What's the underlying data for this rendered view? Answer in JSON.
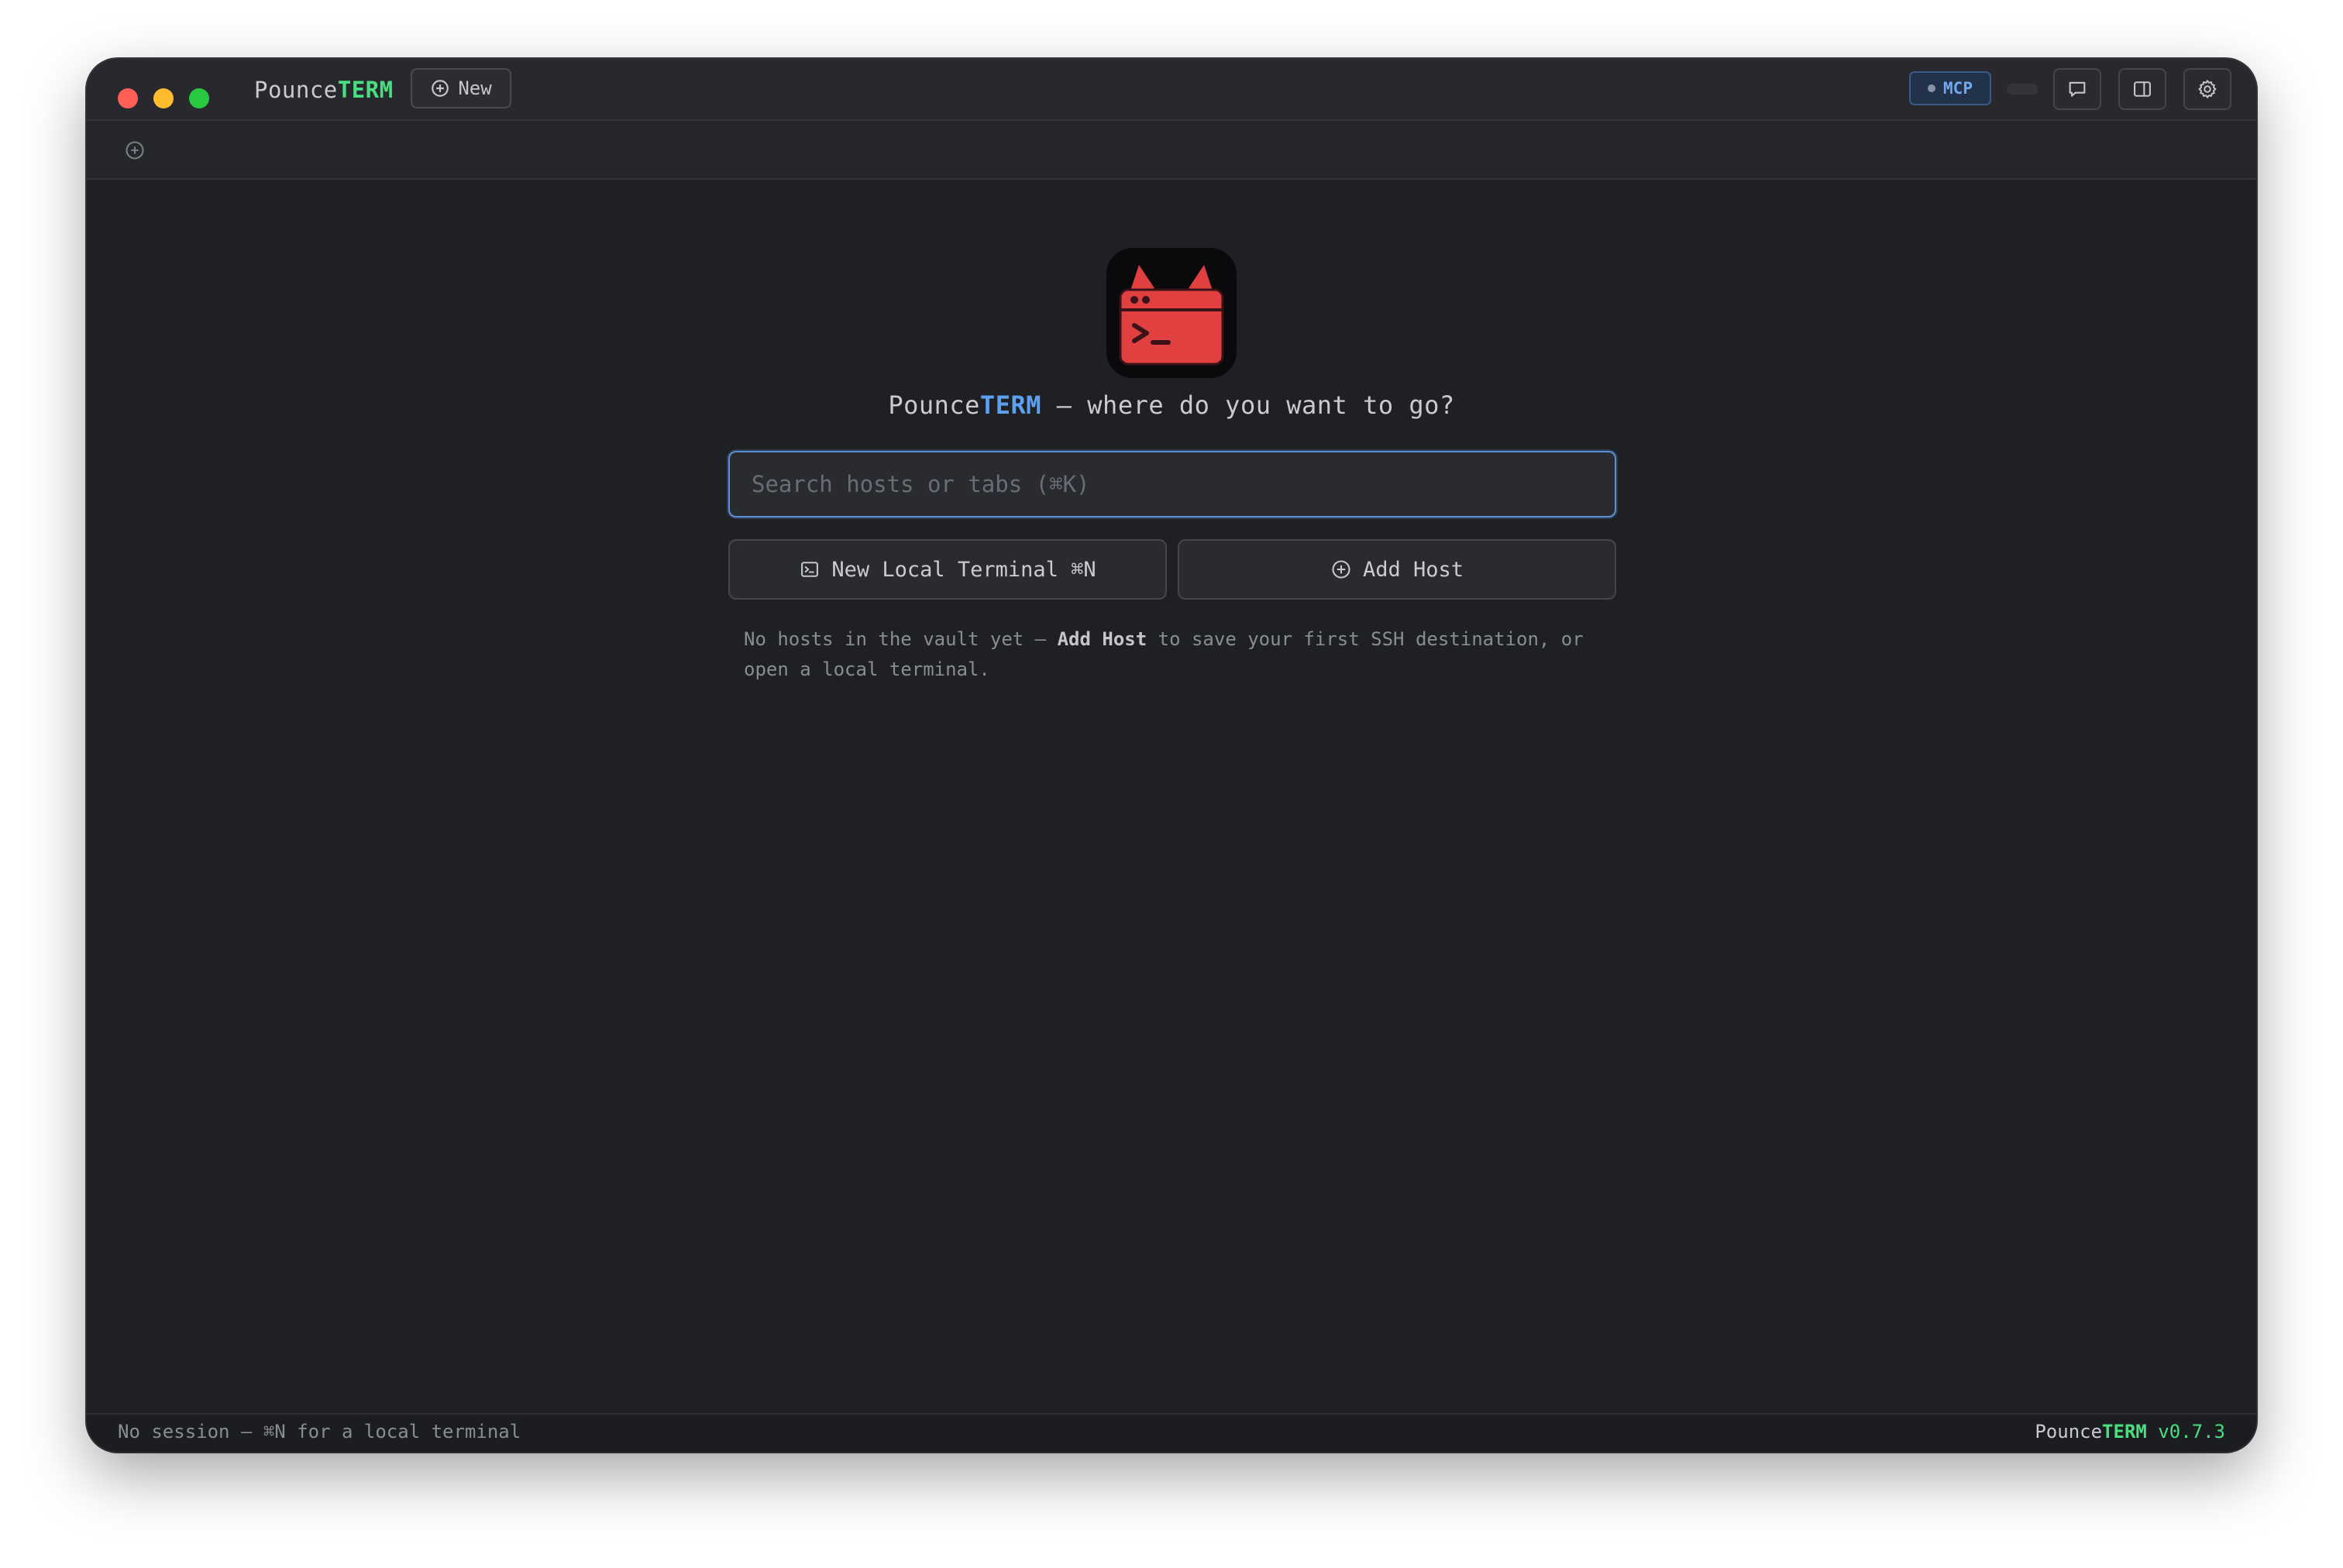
{
  "titlebar": {
    "brand_prefix": "Pounce",
    "brand_suffix": "TERM",
    "new_label": "New",
    "mcp_label": "MCP"
  },
  "welcome": {
    "brand_prefix": "Pounce",
    "brand_suffix": "TERM",
    "tagline": " — where do you want to go?",
    "search_placeholder": "Search hosts or tabs (⌘K)",
    "new_terminal_label": "New Local Terminal ⌘N",
    "add_host_label": "Add Host",
    "hint_before": "No hosts in the vault yet — ",
    "hint_bold": "Add Host",
    "hint_after": " to save your first SSH destination, or open a local terminal."
  },
  "statusbar": {
    "left": "No session — ⌘N for a local terminal",
    "brand_prefix": "Pounce",
    "brand_suffix": "TERM",
    "version": " v0.7.3"
  },
  "colors": {
    "brand_green": "#4ade80",
    "brand_blue": "#5ea0f0",
    "logo_red": "#e0403f"
  },
  "icons": {
    "new": "plus-circle-icon",
    "chat": "chat-icon",
    "sidebar": "sidebar-icon",
    "settings": "gear-icon",
    "terminal": "terminal-icon",
    "add_host": "plus-circle-icon"
  }
}
